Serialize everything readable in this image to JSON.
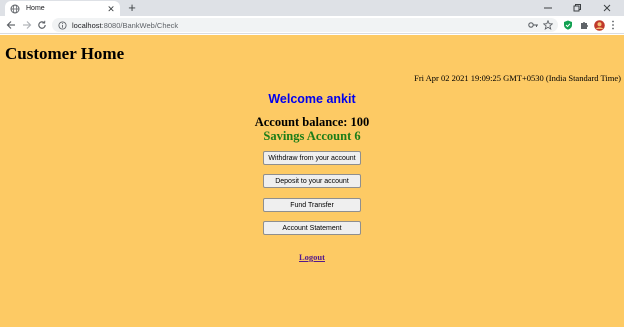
{
  "browser": {
    "tab_title": "Home",
    "url_host": "localhost",
    "url_rest": ":8080/BankWeb/Check"
  },
  "page": {
    "title": "Customer Home",
    "datetime": "Fri Apr 02 2021 19:09:25 GMT+0530 (India Standard Time)",
    "welcome": "Welcome ankit",
    "balance": "Account balance: 100",
    "account_type": "Savings Account 6",
    "buttons": [
      {
        "label": "Withdraw from your account"
      },
      {
        "label": "Deposit to your account"
      },
      {
        "label": "Fund Transfer"
      },
      {
        "label": "Account Statement"
      }
    ],
    "logout": "Logout"
  },
  "colors": {
    "page_background": "#fdca64",
    "welcome_text": "#0000ee",
    "account_type_text": "#1b7d18",
    "link_visited": "#551a8b"
  }
}
